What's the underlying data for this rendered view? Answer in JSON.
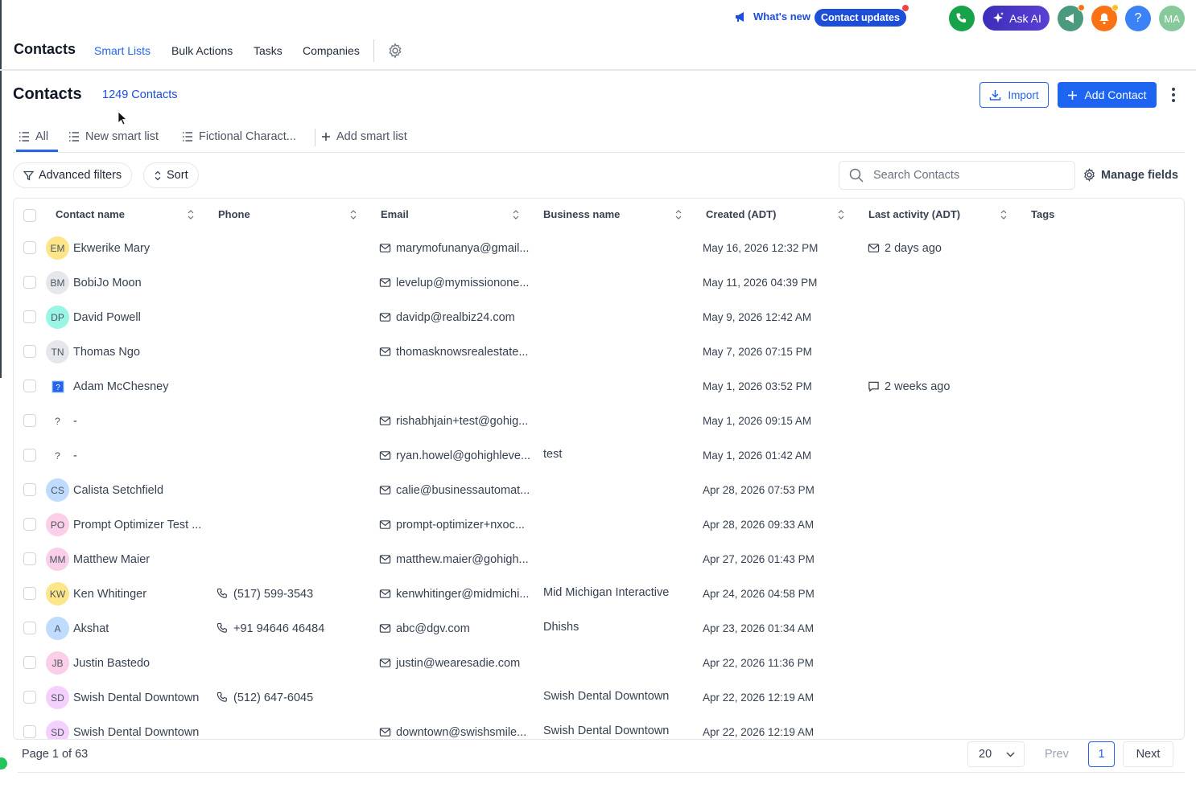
{
  "topbar": {
    "whats_new": "What's new",
    "contact_updates": "Contact updates",
    "ask_ai": "Ask AI",
    "help": "?",
    "user_initials": "MA",
    "colors": {
      "phone": "#16a34a",
      "campaign": "#4b9a7e",
      "notify": "#f97316",
      "help": "#3b82f6",
      "user": "#86c99a"
    }
  },
  "nav": {
    "title": "Contacts",
    "tabs": [
      "Smart Lists",
      "Bulk Actions",
      "Tasks",
      "Companies"
    ],
    "active_tab": "Smart Lists"
  },
  "header": {
    "title": "Contacts",
    "count": "1249 Contacts",
    "import_label": "Import",
    "add_label": "Add Contact"
  },
  "smart_lists": {
    "tabs": [
      "All",
      "New smart list",
      "Fictional Charact..."
    ],
    "add_label": "Add smart list"
  },
  "filters": {
    "advanced": "Advanced filters",
    "sort": "Sort",
    "search_placeholder": "Search Contacts",
    "manage_fields": "Manage fields"
  },
  "table": {
    "columns": [
      "Contact name",
      "Phone",
      "Email",
      "Business name",
      "Created (ADT)",
      "Last activity (ADT)",
      "Tags"
    ],
    "rows": [
      {
        "initials": "EM",
        "avatar_color": "#fde68a",
        "name": "Ekwerike Mary",
        "phone": "",
        "email": "marymofunanya@gmail...",
        "business": "",
        "created": "May 16, 2026 12:32 PM",
        "activity": "2 days ago",
        "activity_icon": "mail-icon"
      },
      {
        "initials": "BM",
        "avatar_color": "#e5e7eb",
        "name": "BobiJo Moon",
        "phone": "",
        "email": "levelup@mymissionone...",
        "business": "",
        "created": "May 11, 2026 04:39 PM",
        "activity": "",
        "activity_icon": ""
      },
      {
        "initials": "DP",
        "avatar_color": "#99f6e4",
        "name": "David Powell",
        "phone": "",
        "email": "davidp@realbiz24.com",
        "business": "",
        "created": "May 9, 2026 12:42 AM",
        "activity": "",
        "activity_icon": ""
      },
      {
        "initials": "TN",
        "avatar_color": "#e5e7eb",
        "name": "Thomas Ngo",
        "phone": "",
        "email": "thomasknowsrealestate...",
        "business": "",
        "created": "May 7, 2026 07:15 PM",
        "activity": "",
        "activity_icon": ""
      },
      {
        "initials": "img",
        "avatar_color": "#ffffff",
        "name": "Adam McChesney",
        "phone": "",
        "email": "",
        "business": "",
        "created": "May 1, 2026 03:52 PM",
        "activity": "2 weeks ago",
        "activity_icon": "chat-icon"
      },
      {
        "initials": "?",
        "avatar_color": "#ffffff",
        "name": "-",
        "phone": "",
        "email": "rishabhjain+test@gohig...",
        "business": "",
        "created": "May 1, 2026 09:15 AM",
        "activity": "",
        "activity_icon": ""
      },
      {
        "initials": "?",
        "avatar_color": "#ffffff",
        "name": "-",
        "phone": "",
        "email": "ryan.howel@gohighleve...",
        "business": "test",
        "created": "May 1, 2026 01:42 AM",
        "activity": "",
        "activity_icon": ""
      },
      {
        "initials": "CS",
        "avatar_color": "#bfdbfe",
        "name": "Calista Setchfield",
        "phone": "",
        "email": "calie@businessautomat...",
        "business": "",
        "created": "Apr 28, 2026 07:53 PM",
        "activity": "",
        "activity_icon": ""
      },
      {
        "initials": "PO",
        "avatar_color": "#fbcfe8",
        "name": "Prompt Optimizer Test ...",
        "phone": "",
        "email": "prompt-optimizer+nxoc...",
        "business": "",
        "created": "Apr 28, 2026 09:33 AM",
        "activity": "",
        "activity_icon": ""
      },
      {
        "initials": "MM",
        "avatar_color": "#fbcfe8",
        "name": "Matthew Maier",
        "phone": "",
        "email": "matthew.maier@gohigh...",
        "business": "",
        "created": "Apr 27, 2026 01:43 PM",
        "activity": "",
        "activity_icon": ""
      },
      {
        "initials": "KW",
        "avatar_color": "#fde68a",
        "name": "Ken Whitinger",
        "phone": "(517) 599-3543",
        "email": "kenwhitinger@midmichi...",
        "business": "Mid Michigan Interactive",
        "created": "Apr 24, 2026 04:58 PM",
        "activity": "",
        "activity_icon": ""
      },
      {
        "initials": "A",
        "avatar_color": "#bfdbfe",
        "name": "Akshat",
        "phone": "+91 94646 46484",
        "email": "abc@dgv.com",
        "business": "Dhishs",
        "created": "Apr 23, 2026 01:34 AM",
        "activity": "",
        "activity_icon": ""
      },
      {
        "initials": "JB",
        "avatar_color": "#fbcfe8",
        "name": "Justin Bastedo",
        "phone": "",
        "email": "justin@wearesadie.com",
        "business": "",
        "created": "Apr 22, 2026 11:36 PM",
        "activity": "",
        "activity_icon": ""
      },
      {
        "initials": "SD",
        "avatar_color": "#f5d0fe",
        "name": "Swish Dental Downtown",
        "phone": "(512) 647-6045",
        "email": "",
        "business": "Swish Dental Downtown",
        "created": "Apr 22, 2026 12:19 AM",
        "activity": "",
        "activity_icon": ""
      },
      {
        "initials": "SD",
        "avatar_color": "#f5d0fe",
        "name": "Swish Dental Downtown",
        "phone": "",
        "email": "downtown@swishsmile...",
        "business": "Swish Dental Downtown",
        "created": "Apr 22, 2026 12:19 AM",
        "activity": "",
        "activity_icon": ""
      }
    ]
  },
  "pagination": {
    "page_info": "Page 1 of 63",
    "per_page": "20",
    "prev": "Prev",
    "current": "1",
    "next": "Next"
  }
}
